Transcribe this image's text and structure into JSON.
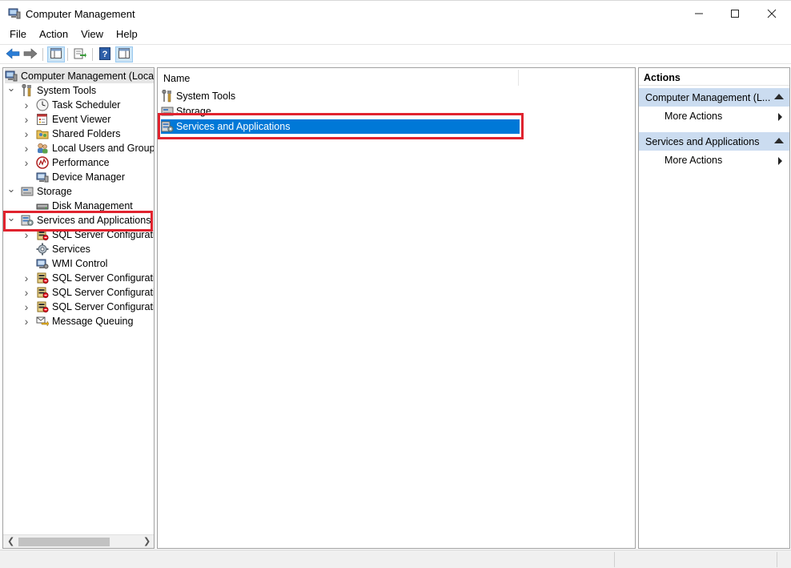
{
  "window": {
    "title": "Computer Management"
  },
  "menu": [
    "File",
    "Action",
    "View",
    "Help"
  ],
  "tree": {
    "root_label": "Computer Management (Local",
    "items": [
      {
        "label": "System Tools",
        "icon": "tools-icon",
        "level": 1,
        "expanded": true
      },
      {
        "label": "Task Scheduler",
        "icon": "clock-icon",
        "level": 2,
        "expanded": false
      },
      {
        "label": "Event Viewer",
        "icon": "event-viewer-icon",
        "level": 2,
        "expanded": false
      },
      {
        "label": "Shared Folders",
        "icon": "shared-folders-icon",
        "level": 2,
        "expanded": false
      },
      {
        "label": "Local Users and Groups",
        "icon": "users-icon",
        "level": 2,
        "expanded": false
      },
      {
        "label": "Performance",
        "icon": "performance-icon",
        "level": 2,
        "expanded": false
      },
      {
        "label": "Device Manager",
        "icon": "device-manager-icon",
        "level": 2,
        "expanded": null
      },
      {
        "label": "Storage",
        "icon": "storage-icon",
        "level": 1,
        "expanded": true
      },
      {
        "label": "Disk Management",
        "icon": "disk-icon",
        "level": 2,
        "expanded": null
      },
      {
        "label": "Services and Applications",
        "icon": "services-apps-icon",
        "level": 1,
        "expanded": true
      },
      {
        "label": "SQL Server Configuratic",
        "icon": "sql-server-icon",
        "level": 2,
        "expanded": false
      },
      {
        "label": "Services",
        "icon": "services-gear-icon",
        "level": 2,
        "expanded": null
      },
      {
        "label": "WMI Control",
        "icon": "wmi-icon",
        "level": 2,
        "expanded": null
      },
      {
        "label": "SQL Server Configuratic",
        "icon": "sql-server-icon",
        "level": 2,
        "expanded": false
      },
      {
        "label": "SQL Server Configuratic",
        "icon": "sql-server-icon",
        "level": 2,
        "expanded": false
      },
      {
        "label": "SQL Server Configuratic",
        "icon": "sql-server-icon",
        "level": 2,
        "expanded": false
      },
      {
        "label": "Message Queuing",
        "icon": "message-queuing-icon",
        "level": 2,
        "expanded": false
      }
    ]
  },
  "list": {
    "column_name": "Name",
    "rows": [
      {
        "label": "System Tools",
        "icon": "tools-icon",
        "selected": false
      },
      {
        "label": "Storage",
        "icon": "storage-icon",
        "selected": false
      },
      {
        "label": "Services and Applications",
        "icon": "services-apps-icon",
        "selected": true
      }
    ]
  },
  "actions": {
    "title": "Actions",
    "groups": [
      {
        "label": "Computer Management (L...",
        "items": [
          "More Actions"
        ]
      },
      {
        "label": "Services and Applications",
        "items": [
          "More Actions"
        ]
      }
    ]
  },
  "colors": {
    "selection": "#0078d7",
    "highlight": "#e0232e",
    "action_group_bg": "#cbdcf0"
  }
}
